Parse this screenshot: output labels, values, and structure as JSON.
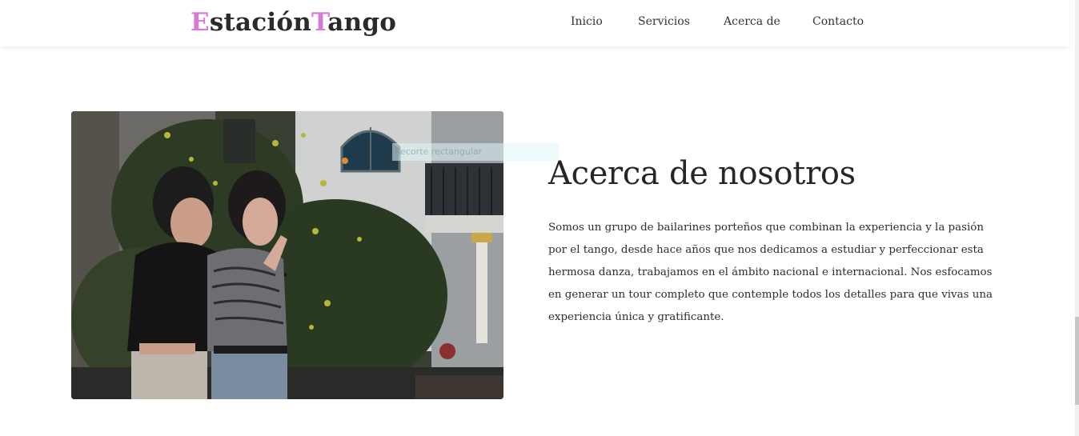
{
  "header": {
    "logo": {
      "first_initial": "E",
      "first_rest": "stación",
      "second_initial": "T",
      "second_rest": "ango",
      "accent_color": "#d67ad6"
    },
    "nav": {
      "items": [
        {
          "label": "Inicio"
        },
        {
          "label": "Servicios"
        },
        {
          "label": "Acerca de"
        },
        {
          "label": "Contacto"
        }
      ]
    }
  },
  "about": {
    "overlay_label": "Recorte rectangular",
    "title": "Acerca de nosotros",
    "body": "Somos un grupo de bailarines porteños que combinan la experiencia y la pasión por el tango, desde hace años que nos dedicamos a estudiar y perfeccionar esta hermosa danza, trabajamos en el ámbito nacional e internacional. Nos esfocamos en generar un tour completo que contemple todos los detalles para que vivas una experiencia única y gratificante."
  }
}
